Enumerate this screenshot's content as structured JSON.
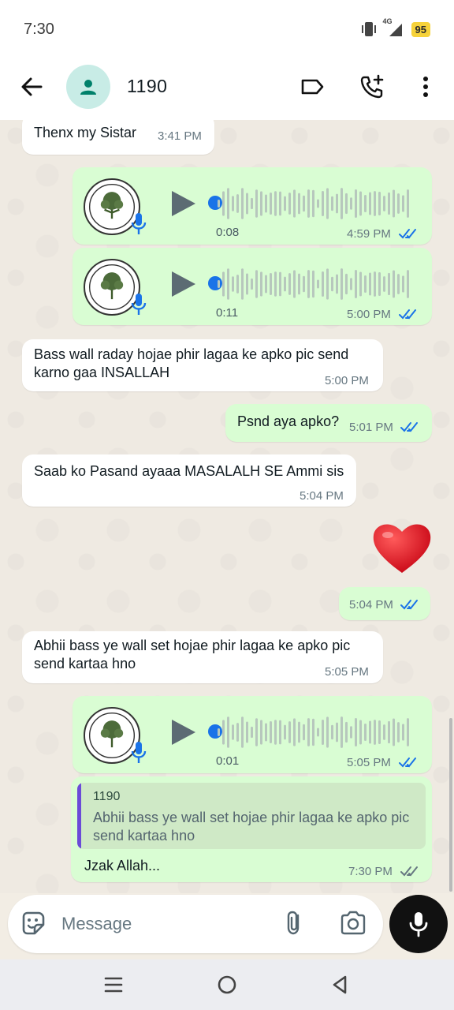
{
  "status_bar": {
    "time": "7:30",
    "network": "4G",
    "battery": "95"
  },
  "header": {
    "contact_name": "1190"
  },
  "messages": [
    {
      "dir": "in",
      "text": "Thenx my Sistar",
      "time": "3:41 PM"
    },
    {
      "dir": "out",
      "type": "voice",
      "duration": "0:08",
      "time": "4:59 PM",
      "read": true
    },
    {
      "dir": "out",
      "type": "voice",
      "duration": "0:11",
      "time": "5:00 PM",
      "read": true
    },
    {
      "dir": "in",
      "text": "Bass wall raday hojae phir lagaa ke apko pic send karno gaa INSALLAH",
      "time": "5:00 PM"
    },
    {
      "dir": "out",
      "text": "Psnd aya apko?",
      "time": "5:01 PM",
      "read": true
    },
    {
      "dir": "in",
      "text": "Saab ko Pasand ayaaa MASALALH SE Ammi sis",
      "time": "5:04 PM"
    },
    {
      "dir": "out",
      "type": "emoji",
      "emoji": "❤️",
      "time": "5:04 PM",
      "read": true
    },
    {
      "dir": "in",
      "text": "Abhii bass ye wall set hojae phir lagaa ke apko pic send kartaa hno",
      "time": "5:05 PM"
    },
    {
      "dir": "out",
      "type": "voice",
      "duration": "0:01",
      "time": "5:05 PM",
      "read": true
    },
    {
      "dir": "out",
      "type": "reply",
      "quoted_name": "1190",
      "quoted_text": "Abhii bass ye wall set hojae phir lagaa ke apko pic send kartaa hno",
      "text": "Jzak Allah...",
      "time": "7:30 PM",
      "read": false
    }
  ],
  "voice_avatar_label": "SHESHUM",
  "composer": {
    "placeholder": "Message"
  },
  "colors": {
    "outgoing": "#d9fdd3",
    "incoming": "#ffffff",
    "read_tick": "#1a73e8",
    "accent": "#008069"
  },
  "icons": [
    "back-arrow-icon",
    "person-icon",
    "label-icon",
    "add-call-icon",
    "more-vert-icon",
    "play-icon",
    "mic-icon",
    "sticker-icon",
    "attach-icon",
    "camera-icon",
    "menu-icon",
    "home-icon",
    "back-icon"
  ]
}
